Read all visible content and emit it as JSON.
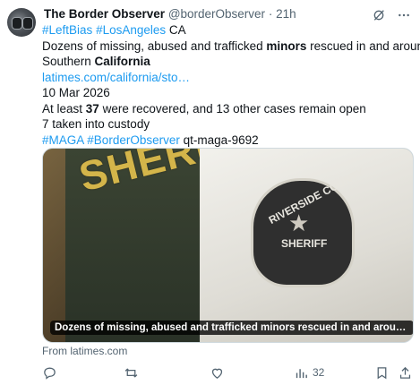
{
  "author": {
    "name": "The Border Observer",
    "handle": "@borderObserver",
    "separator": "·",
    "time": "21h"
  },
  "tweet": {
    "line1": {
      "hashtag1": "#LeftBias",
      "hashtag2": "#LosAngeles",
      "suffix": " CA"
    },
    "line2": {
      "part1": "Dozens of missing, abused and trafficked ",
      "bold": "minors",
      "part2": " rescued in and around"
    },
    "line3": {
      "part1": "Southern ",
      "bold": "California"
    },
    "link": "latimes.com/california/sto…",
    "date": "10 Mar 2026",
    "line6": {
      "part1": "At least ",
      "bold": "37",
      "part2": " were recovered, and 13 other cases remain open"
    },
    "line7": "7 taken into custody",
    "line8": {
      "hashtag1": "#MAGA",
      "hashtag2": "#BorderObserver",
      "suffix": " qt-maga-9692"
    }
  },
  "media": {
    "patch_text": "SHERIFF",
    "badge_top": "RIVERSIDE COUNTY",
    "badge_bottom": "SHERIFF",
    "caption": "Dozens of missing, abused and trafficked minors rescued in and around South…",
    "from": "From latimes.com"
  },
  "actions": {
    "reply_count": "",
    "retweet_count": "",
    "like_count": "",
    "views_count": "32"
  },
  "icons": [
    "grok-icon",
    "more-icon",
    "reply-icon",
    "retweet-icon",
    "like-icon",
    "views-icon",
    "bookmark-icon",
    "share-icon"
  ],
  "colors": {
    "link": "#1d9bf0",
    "secondary_text": "#536471",
    "text": "#0f1419"
  }
}
